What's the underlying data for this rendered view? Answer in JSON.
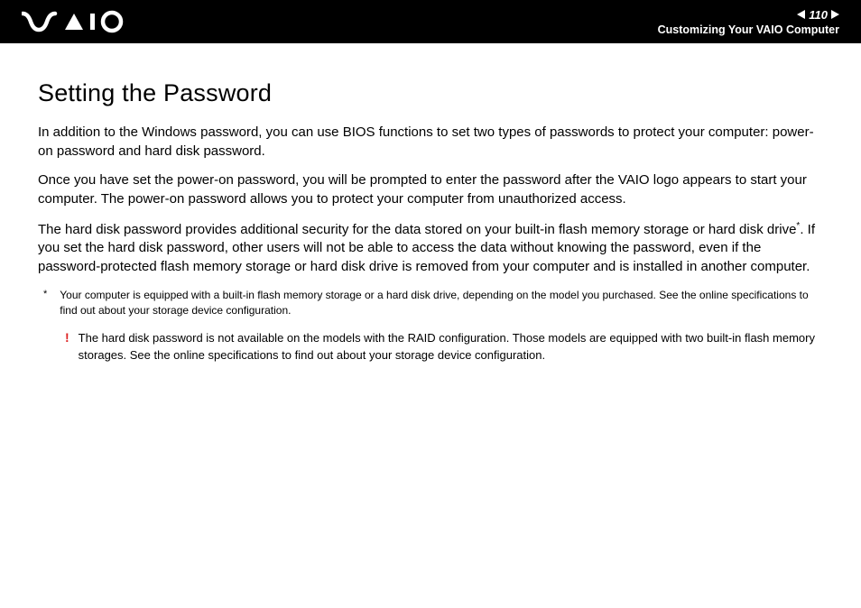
{
  "header": {
    "page_number": "110",
    "breadcrumb": "Customizing Your VAIO Computer"
  },
  "content": {
    "title": "Setting the Password",
    "para1": "In addition to the Windows password, you can use BIOS functions to set two types of passwords to protect your computer: power-on password and hard disk password.",
    "para2": "Once you have set the power-on password, you will be prompted to enter the password after the VAIO logo appears to start your computer. The power-on password allows you to protect your computer from unauthorized access.",
    "para3a": "The hard disk password provides additional security for the data stored on your built-in flash memory storage or hard disk drive",
    "para3_sup": "*",
    "para3b": ". If you set the hard disk password, other users will not be able to access the data without knowing the password, even if the password-protected flash memory storage or hard disk drive is removed from your computer and is installed in another computer.",
    "footnote_marker": "*",
    "footnote_text": "Your computer is equipped with a built-in flash memory storage or a hard disk drive, depending on the model you purchased. See the online specifications to find out about your storage device configuration.",
    "warning_marker": "!",
    "warning_text": "The hard disk password is not available on the models with the RAID configuration. Those models are equipped with two built-in flash memory storages. See the online specifications to find out about your storage device configuration."
  }
}
